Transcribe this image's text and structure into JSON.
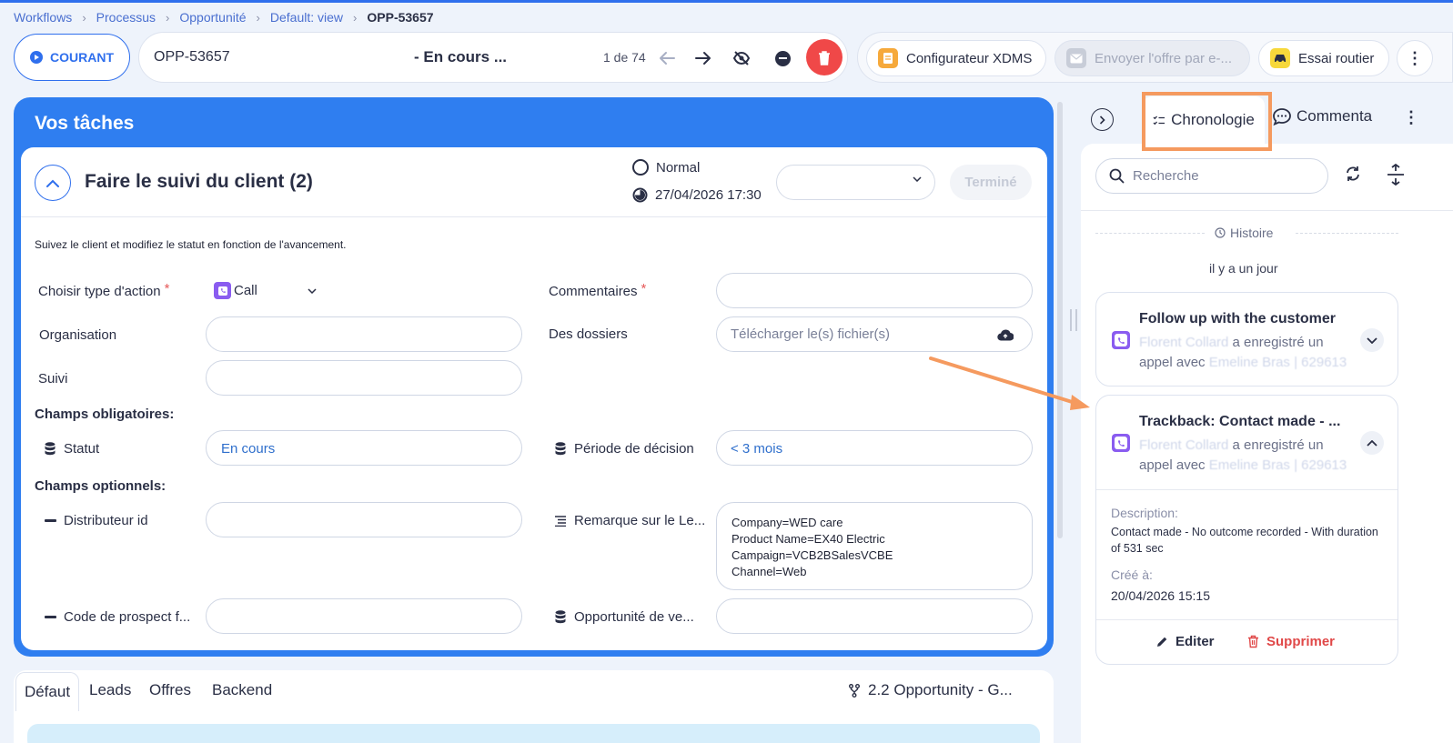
{
  "breadcrumb": {
    "items": [
      "Workflows",
      "Processus",
      "Opportunité",
      "Default: view"
    ],
    "current": "OPP-53657"
  },
  "toolbar": {
    "status_label": "COURANT",
    "record_id": "OPP-53657",
    "record_status": "- En cours ...",
    "record_count": "1 de 74"
  },
  "actions": {
    "configurator": "Configurateur XDMS",
    "send_offer": "Envoyer l'offre par e-...",
    "road_test": "Essai routier"
  },
  "tasks": {
    "header": "Vos tâches",
    "task_title": "Faire le suivi du client (2)",
    "priority": "Normal",
    "due_date": "27/04/2026 17:30",
    "done_label": "Terminé",
    "description": "Suivez le client et modifiez le statut en fonction de l'avancement.",
    "fields": {
      "action_type_label": "Choisir type d'action",
      "action_type_value": "Call",
      "comments_label": "Commentaires",
      "organisation_label": "Organisation",
      "files_label": "Des dossiers",
      "files_placeholder": "Télécharger le(s) fichier(s)",
      "followup_label": "Suivi",
      "mandatory_section": "Champs obligatoires:",
      "status_label": "Statut",
      "status_value": "En cours",
      "decision_label": "Période de décision",
      "decision_value": "< 3 mois",
      "optional_section": "Champs optionnels:",
      "distributor_label": "Distributeur id",
      "remark_label": "Remarque sur le Le...",
      "remark_value": "Company=WED care\nProduct Name=EX40 Electric\nCampaign=VCB2BSalesVCBE\nChannel=Web",
      "prospect_label": "Code de prospect f...",
      "sale_opportunity_label": "Opportunité de ve..."
    }
  },
  "bottom_tabs": {
    "tabs": [
      "Défaut",
      "Leads",
      "Offres",
      "Backend"
    ],
    "flow": "2.2 Opportunity - G..."
  },
  "right_panel": {
    "tab_timeline": "Chronologie",
    "tab_comments": "Commenta",
    "search_placeholder": "Recherche",
    "history_label": "Histoire",
    "history_day": "il y a un jour",
    "card1": {
      "title": "Follow up with the customer",
      "line1": "a enregistré un",
      "line2": "appel avec"
    },
    "card2": {
      "title": "Trackback: Contact made - ...",
      "line1": "a enregistré un",
      "line2": "appel avec",
      "description_label": "Description:",
      "description": "Contact made - No outcome recorded - With duration of 531 sec",
      "created_label": "Créé à:",
      "created_date": "20/04/2026 15:15",
      "edit_label": "Editer",
      "delete_label": "Supprimer"
    }
  },
  "colors": {
    "accent": "#2f6fed",
    "task_panel": "#2f7ef0",
    "danger": "#f04848",
    "highlight": "#f59a5f",
    "call_icon": "#8a5cf0"
  },
  "icons": [
    "play-icon",
    "arrow-left-icon",
    "arrow-right-icon",
    "eye-off-icon",
    "minus-circle-icon",
    "trash-icon",
    "document-icon",
    "mail-icon",
    "car-icon",
    "more-icon",
    "chevron-up-icon",
    "chevron-down-icon",
    "clock-icon",
    "phone-icon",
    "database-icon",
    "upload-icon",
    "text-lines-icon",
    "flow-icon",
    "chevron-right-icon",
    "checklist-icon",
    "comment-icon",
    "search-icon",
    "refresh-icon",
    "expand-icon",
    "history-icon",
    "pencil-icon"
  ]
}
